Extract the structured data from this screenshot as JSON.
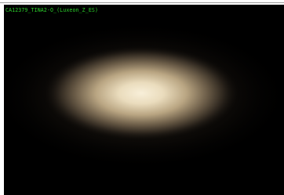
{
  "image": {
    "caption": "CA12379_TINA2-O_(Luxeon_Z_ES)",
    "caption_color": "#2bd12b",
    "background_color": "#000000",
    "beam_color": "#f2e6cd"
  }
}
